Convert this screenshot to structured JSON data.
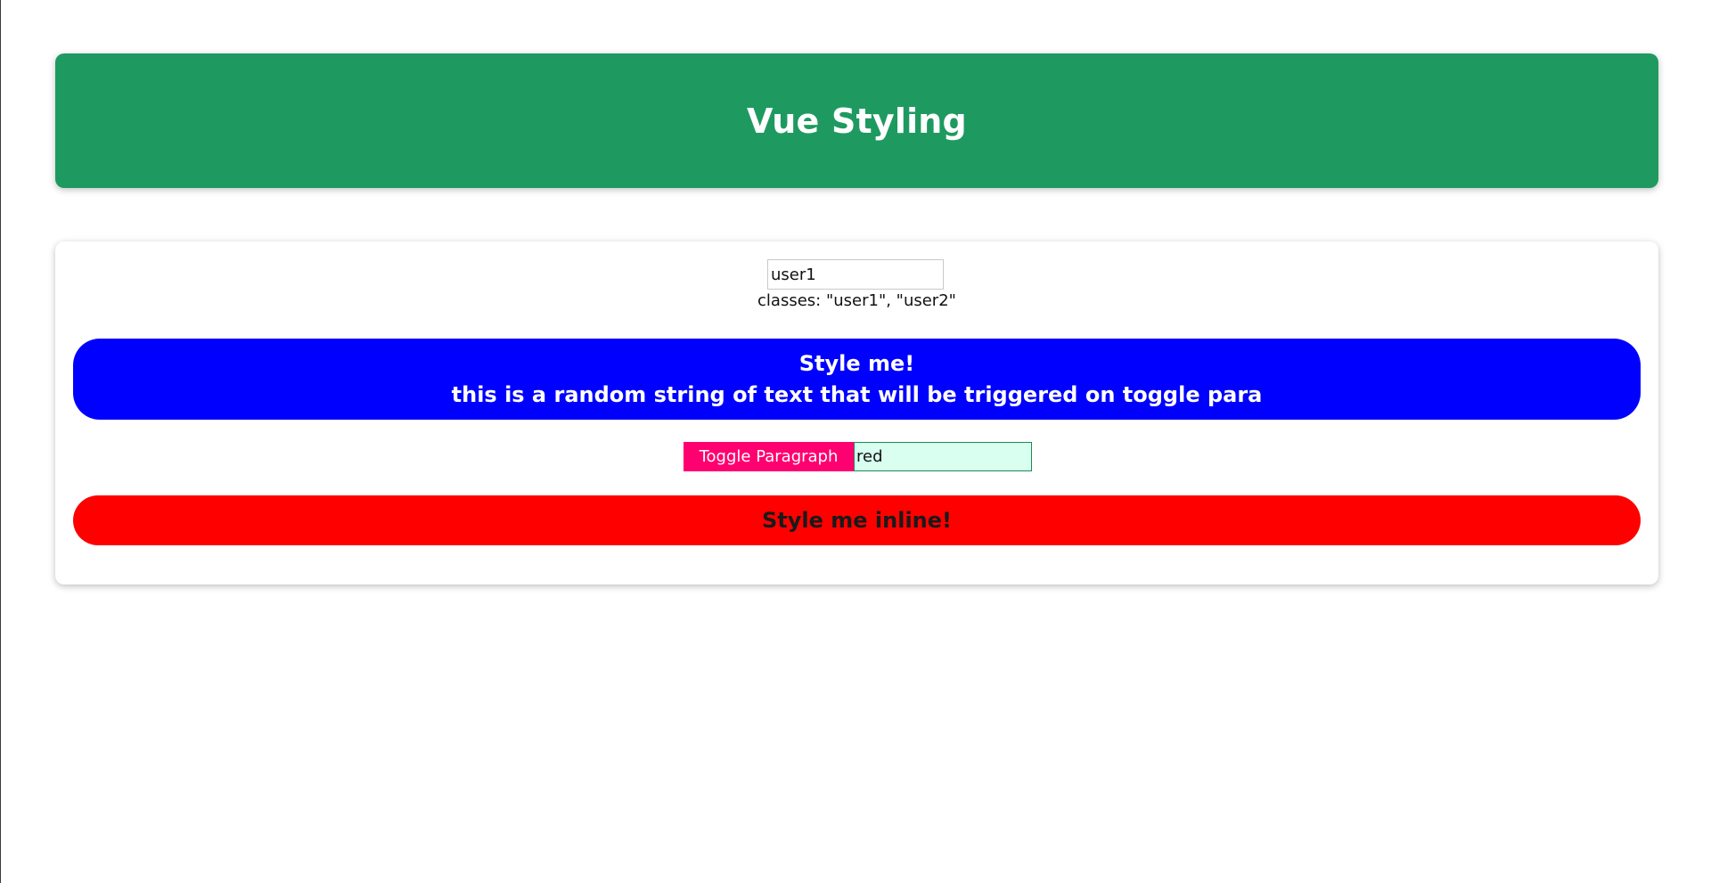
{
  "header": {
    "title": "Vue Styling",
    "background": "#1e9a60"
  },
  "controls": {
    "class_input_value": "user1",
    "classes_text": "classes: \"user1\", \"user2\"",
    "toggle_label": "Toggle Paragraph",
    "color_input_value": "red"
  },
  "style_box": {
    "title": "Style me!",
    "paragraph": "this is a random string of text that will be triggered on toggle para",
    "background": "#0000ff"
  },
  "inline_box": {
    "label": "Style me inline!",
    "background": "#ff0000"
  },
  "colors": {
    "toggle_button": "#ff0070",
    "color_input_bg": "#d8fff0"
  }
}
